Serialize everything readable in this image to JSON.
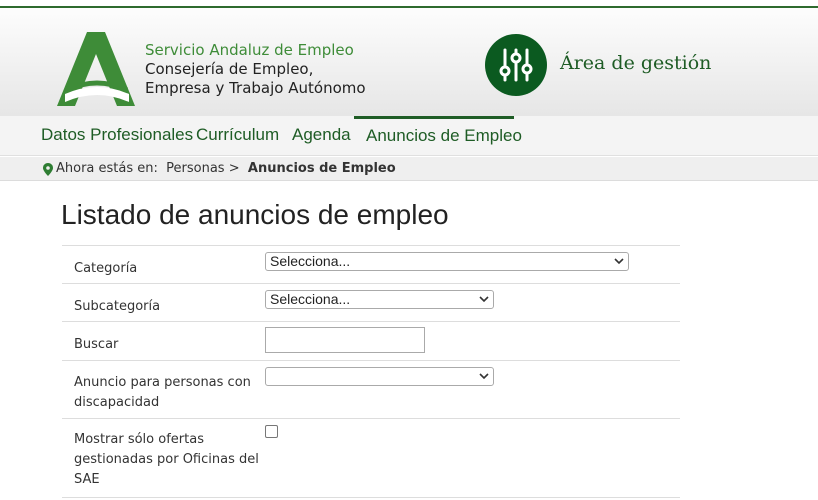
{
  "header": {
    "org_line1": "Servicio Andaluz de Empleo",
    "org_line2": "Consejería de Empleo,",
    "org_line3": "Empresa y Trabajo Autónomo",
    "area_label": "Área de gestión",
    "brand_green": "#1e5c25",
    "logo_green": "#3e8c38"
  },
  "nav": {
    "items": [
      {
        "label": "Datos Profesionales"
      },
      {
        "label": "Currículum"
      },
      {
        "label": "Agenda"
      },
      {
        "label": "Anuncios de Empleo"
      }
    ],
    "active": "Anuncios de Empleo"
  },
  "breadcrumb": {
    "prefix": "Ahora estás en:",
    "parent": "Personas",
    "separator": ">",
    "current": "Anuncios de Empleo"
  },
  "page": {
    "title": "Listado de anuncios de empleo"
  },
  "form": {
    "categoria": {
      "label": "Categoría",
      "value": "Selecciona..."
    },
    "subcategoria": {
      "label": "Subcategoría",
      "value": "Selecciona..."
    },
    "buscar": {
      "label": "Buscar",
      "value": ""
    },
    "discapacidad": {
      "label_line1": "Anuncio para personas con",
      "label_line2": "discapacidad",
      "value": ""
    },
    "oficinas": {
      "label_line1": "Mostrar sólo ofertas",
      "label_line2": "gestionadas por Oficinas del",
      "label_line3": "SAE",
      "checked": false
    }
  }
}
